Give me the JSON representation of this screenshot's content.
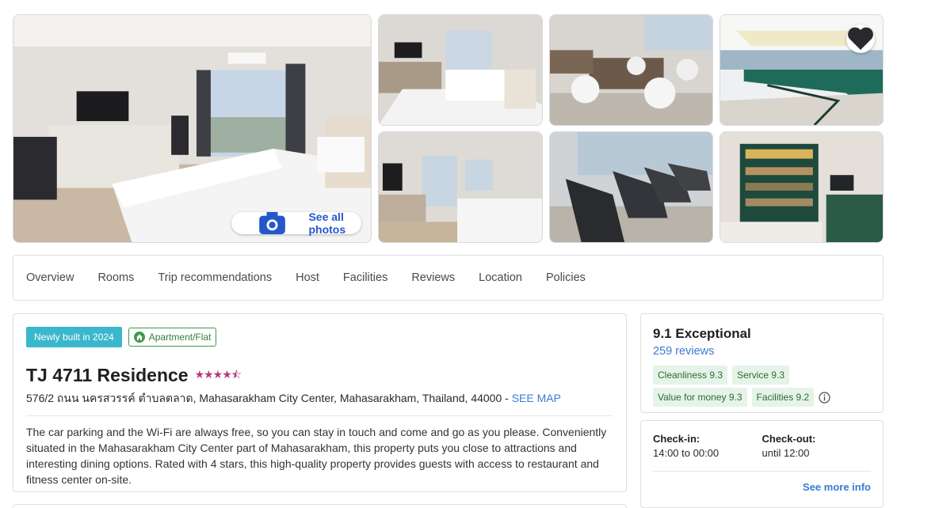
{
  "gallery": {
    "see_all_label": "See all photos"
  },
  "tabs": [
    "Overview",
    "Rooms",
    "Trip recommendations",
    "Host",
    "Facilities",
    "Reviews",
    "Location",
    "Policies"
  ],
  "property": {
    "badge_new": "Newly built in 2024",
    "badge_type": "Apartment/Flat",
    "name": "TJ 4711 Residence",
    "stars": 4.5,
    "stars_display": "★★★★⯪",
    "address": "576/2 ถนน นครสวรรค์ ตำบลตลาด, Mahasarakham City Center, Mahasarakham, Thailand, 44000 - ",
    "see_map": "SEE MAP",
    "description": "The car parking and the Wi-Fi are always free, so you can stay in touch and come and go as you please. Conveniently situated in the Mahasarakham City Center part of Mahasarakham, this property puts you close to attractions and interesting dining options. Rated with 4 stars, this high-quality property provides guests with access to restaurant and fitness center on-site."
  },
  "rating": {
    "score_text": "9.1 Exceptional",
    "reviews_text": "259 reviews",
    "chips": [
      "Cleanliness 9.3",
      "Service 9.3",
      "Value for money 9.3",
      "Facilities 9.2"
    ]
  },
  "checkin": {
    "in_label": "Check-in:",
    "in_value": "14:00 to 00:00",
    "out_label": "Check-out:",
    "out_value": "until 12:00",
    "see_more": "See more info"
  },
  "colors": {
    "link": "#3a7bd5",
    "badge_new": "#3ab7cc",
    "chip_bg": "#e6f3e8",
    "star": "#b63a7c"
  }
}
